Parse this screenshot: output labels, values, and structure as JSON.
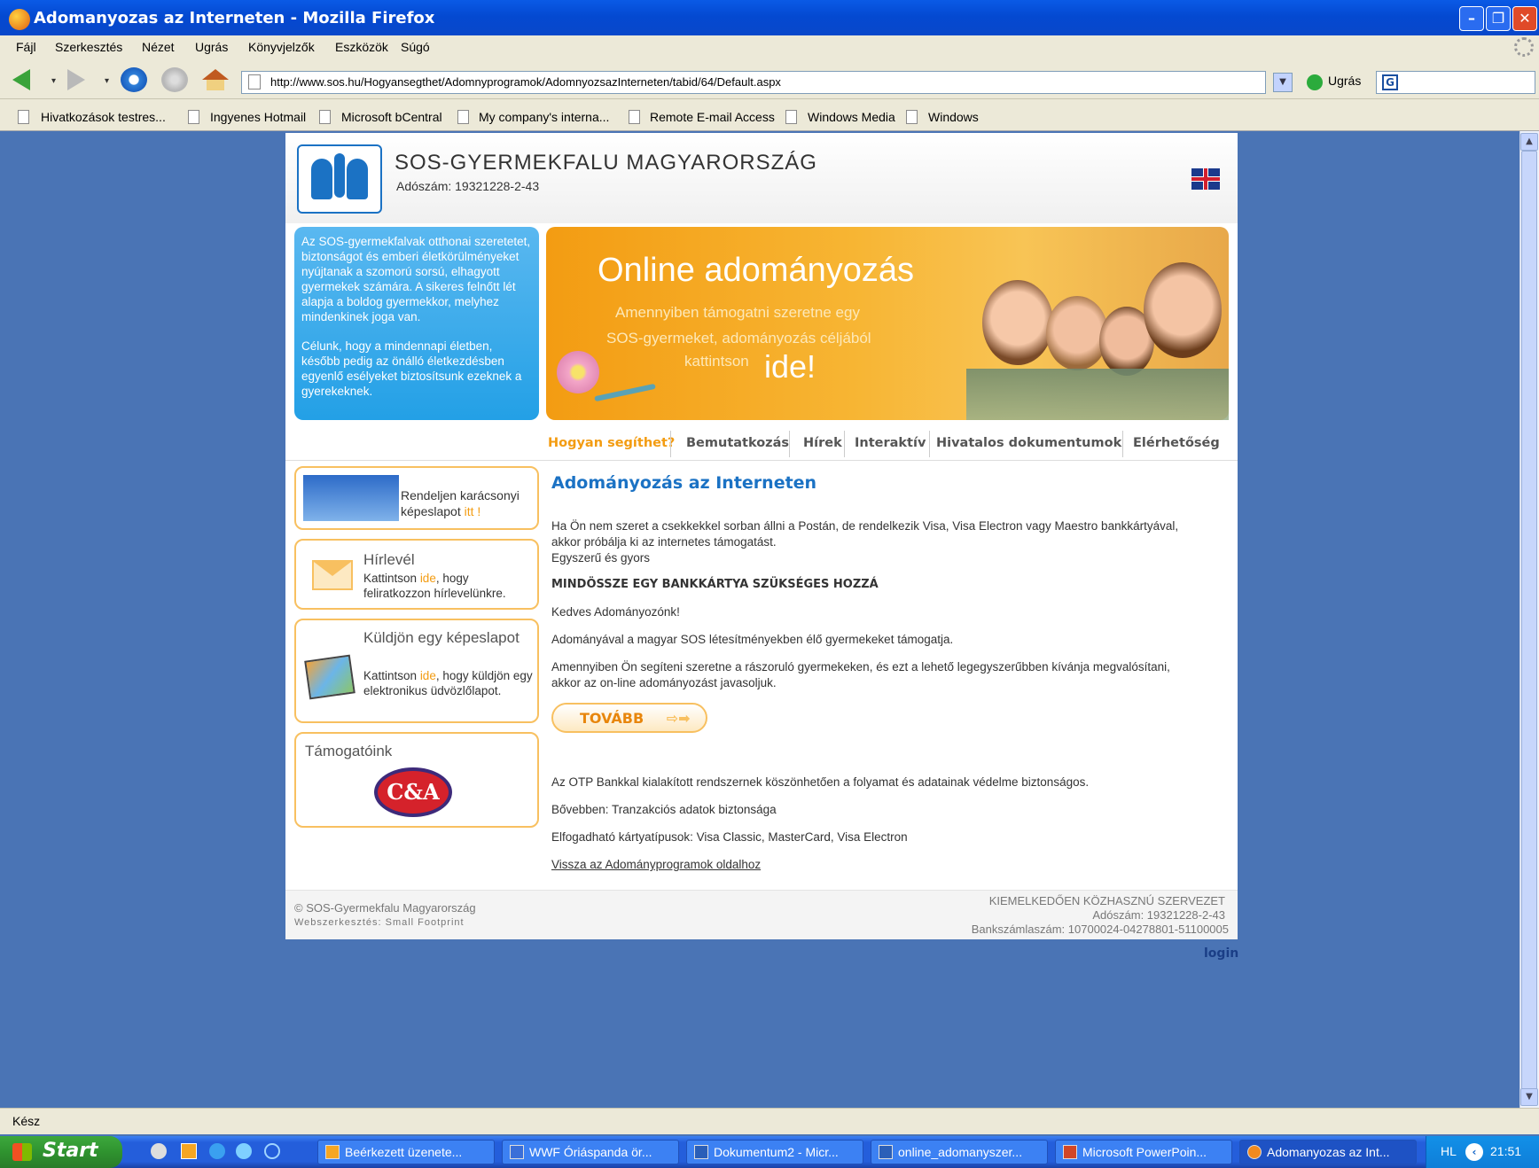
{
  "window": {
    "title": "Adomanyozas az Interneten - Mozilla Firefox"
  },
  "menu": [
    "Fájl",
    "Szerkesztés",
    "Nézet",
    "Ugrás",
    "Könyvjelzők",
    "Eszközök",
    "Súgó"
  ],
  "address": {
    "url": "http://www.sos.hu/Hogyansegthet/Adomnyprogramok/AdomnyozsazInterneten/tabid/64/Default.aspx",
    "go_label": "Ugrás"
  },
  "bookmarks": [
    "Hivatkozások testres...",
    "Ingyenes Hotmail",
    "Microsoft bCentral",
    "My company's interna...",
    "Remote E-mail Access",
    "Windows Media",
    "Windows"
  ],
  "site": {
    "name": "SOS-GYERMEKFALU MAGYARORSZÁG",
    "tax": "Adószám: 19321228-2-43",
    "intro_p1": "Az SOS-gyermekfalvak otthonai szeretetet, biztonságot és emberi életkörülményeket nyújtanak a szomorú sorsú, elhagyott gyermekek számára. A sikeres felnőtt lét alapja a boldog gyermekkor, melyhez mindenkinek joga van.",
    "intro_p2": "Célunk, hogy a mindennapi életben, később pedig az önálló életkezdésben egyenlő esélyeket biztosítsunk ezeknek a gyerekeknek.",
    "banner": {
      "title": "Online adományozás",
      "line1": "Amennyiben támogatni szeretne egy",
      "line2": "SOS-gyermeket, adományozás céljából",
      "line3": "kattintson",
      "line4": "ide!"
    },
    "nav": [
      "Hogyan segíthet?",
      "Bemutatkozás",
      "Hírek",
      "Interaktív",
      "Hivatalos dokumentumok",
      "Elérhetőség"
    ],
    "sidebar": {
      "card": {
        "text": "Rendeljen karácsonyi képeslapot",
        "link": "itt !"
      },
      "newsletter": {
        "title": "Hírlevél",
        "pre": "Kattintson",
        "link": "ide",
        "post": ", hogy feliratkozzon hírlevelünkre."
      },
      "ecard": {
        "title": "Küldjön egy képeslapot",
        "pre": "Kattintson",
        "link": "ide",
        "post": ", hogy küldjön egy elektronikus üdvözlőlapot."
      },
      "sponsors": {
        "title": "Támogatóink",
        "logo": "C&A"
      }
    },
    "content": {
      "title": "Adományozás az Interneten",
      "p1a": "Ha Ön nem szeret a csekkekkel sorban állni a Postán, de rendelkezik Visa, Visa Electron vagy Maestro bankkártyával,",
      "p1b": "akkor próbálja ki az internetes támogatást.",
      "p1c": "Egyszerű és gyors",
      "p2": "MINDÖSSZE EGY BANKKÁRTYA SZÜKSÉGES HOZZÁ",
      "p3": "Kedves Adományozónk!",
      "p4": "Adományával a magyar SOS létesítményekben élő gyermekeket támogatja.",
      "p5a": "Amennyiben Ön segíteni szeretne a rászoruló gyermekeken, és ezt a lehető legegyszerűbben kívánja megvalósítani,",
      "p5b": "akkor az on-line adományozást javasoljuk.",
      "button": "TOVÁBB",
      "p6": "Az OTP Bankkal kialakított rendszernek köszönhetően a folyamat és adatainak védelme biztonságos.",
      "p7": "Bővebben: Tranzakciós adatok biztonsága",
      "p8": "Elfogadható kártyatípusok: Visa Classic, MasterCard, Visa Electron",
      "back_link": "Vissza az Adományprogramok oldalhoz"
    },
    "footer": {
      "copyright": "© SOS-Gyermekfalu Magyarország",
      "webdesign": "Webszerkesztés: Small Footprint",
      "org": "KIEMELKEDŐEN KÖZHASZNÚ SZERVEZET",
      "tax": "Adószám: 19321228-2-43",
      "bank": "Bankszámlaszám: 10700024-04278801-51100005"
    },
    "login": "login"
  },
  "status": "Kész",
  "taskbar": {
    "start": "Start",
    "items": [
      "Beérkezett üzenete...",
      "WWF Óriáspanda ör...",
      "Dokumentum2 - Micr...",
      "online_adomanyszer...",
      "Microsoft PowerPoin...",
      "Adomanyozas az Int..."
    ],
    "lang": "HL",
    "clock": "21:51"
  }
}
